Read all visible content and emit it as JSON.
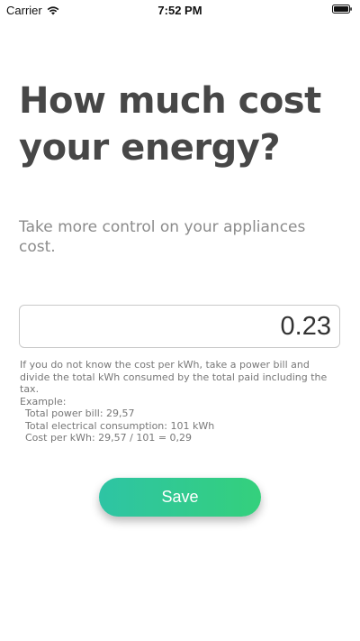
{
  "status_bar": {
    "carrier": "Carrier",
    "time": "7:52 PM",
    "icons": [
      "wifi-icon",
      "battery-icon"
    ]
  },
  "headline": "How much cost your energy?",
  "subtitle": "Take more control on your appliances cost.",
  "cost_input": {
    "value": "0.23"
  },
  "help": {
    "intro": "If you do not know the cost per kWh, take a power bill and divide the total kWh consumed by the total paid including the tax.",
    "example_label": "Example:",
    "lines": [
      "Total power bill:  29,57",
      "Total electrical consumption:  101 kWh",
      "Cost per kWh:  29,57 / 101 = 0,29"
    ]
  },
  "save_label": "Save",
  "colors": {
    "button_gradient_start": "#2ec4a4",
    "button_gradient_end": "#34d07c",
    "heading": "#474747",
    "subtitle": "#8b8b8b"
  }
}
